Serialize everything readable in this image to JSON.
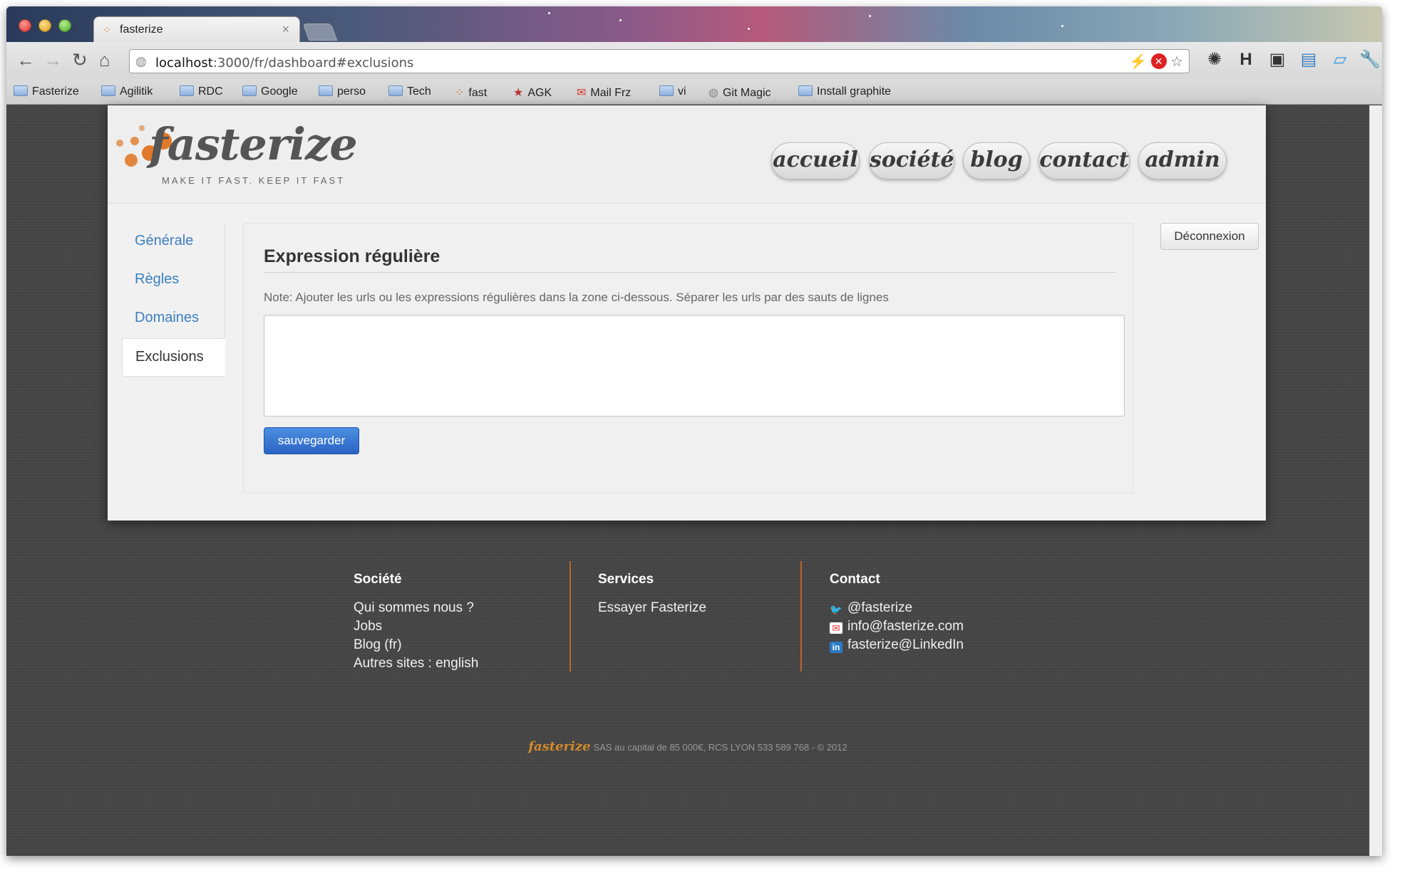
{
  "browser": {
    "tab_title": "fasterize",
    "tab_close": "×",
    "url_host": "localhost",
    "url_rest": ":3000/fr/dashboard#exclusions",
    "bookmarks": [
      "Fasterize",
      "Agilitik",
      "RDC",
      "Google",
      "perso",
      "Tech",
      "fast",
      "AGK",
      "Mail Frz",
      "vi",
      "Git Magic",
      "Install graphite"
    ]
  },
  "header": {
    "logo_text": "fasterize",
    "tagline": "MAKE IT FAST. KEEP IT FAST",
    "nav": [
      "accueil",
      "société",
      "blog",
      "contact",
      "admin"
    ]
  },
  "sidebar": {
    "items": [
      "Générale",
      "Règles",
      "Domaines",
      "Exclusions"
    ],
    "active": "Exclusions"
  },
  "panel": {
    "title": "Expression régulière",
    "note": "Note: Ajouter les urls ou les expressions régulières dans la zone ci-dessous. Séparer les urls par des sauts de lignes",
    "textarea_value": "",
    "save_label": "sauvegarder"
  },
  "logout_label": "Déconnexion",
  "footer": {
    "societe": {
      "title": "Société",
      "links": [
        "Qui sommes nous ?",
        "Jobs",
        "Blog (fr)",
        "Autres sites : english"
      ]
    },
    "services": {
      "title": "Services",
      "links": [
        "Essayer Fasterize"
      ]
    },
    "contact": {
      "title": "Contact",
      "links": [
        "@fasterize",
        "info@fasterize.com",
        "fasterize@LinkedIn"
      ]
    },
    "brand": "fasterize",
    "copyright": "SAS au capital de 85 000€, RCS LYON 533 589 768 - © 2012"
  },
  "colors": {
    "accent": "#e07a2a",
    "link": "#3a7fc1",
    "button": "#2a64c4"
  },
  "icons": [
    "back-icon",
    "forward-icon",
    "reload-icon",
    "home-icon",
    "globe-icon",
    "star-icon",
    "wrench-icon",
    "twitter-icon",
    "mail-icon",
    "linkedin-icon"
  ]
}
